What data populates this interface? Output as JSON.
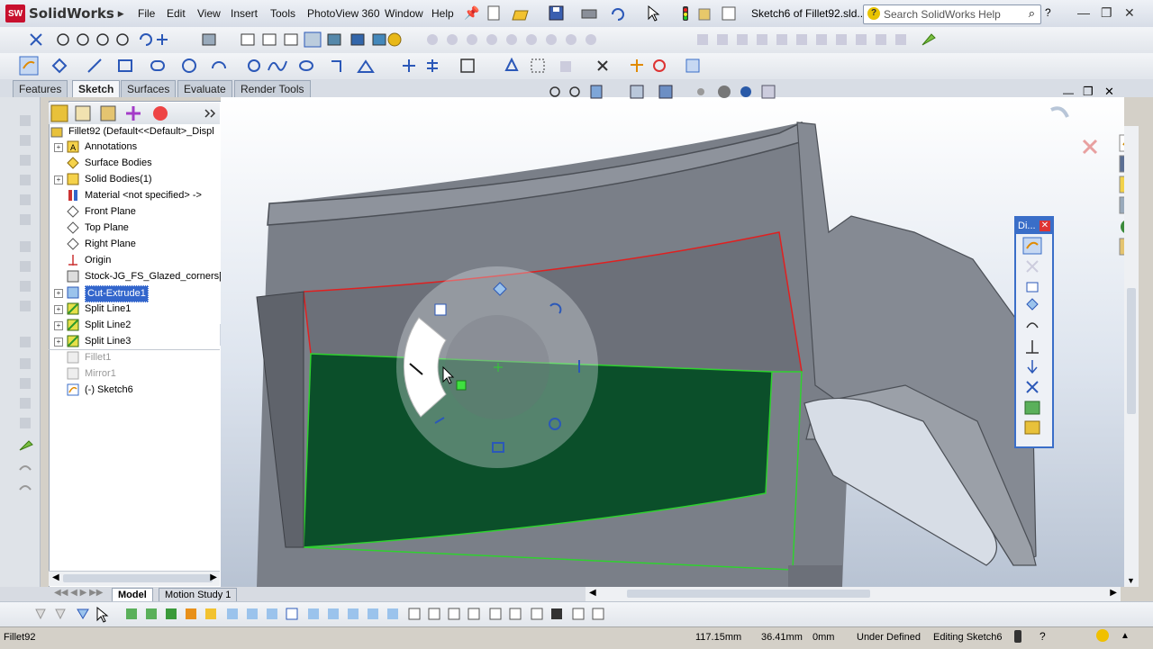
{
  "app": {
    "brand": "SolidWorks",
    "logo_text": "SW",
    "document_title": "Sketch6 of Fillet92.sld...",
    "search_placeholder": "Search SolidWorks Help"
  },
  "menu": [
    "File",
    "Edit",
    "View",
    "Insert",
    "Tools",
    "PhotoView 360",
    "Window",
    "Help"
  ],
  "command_tabs": [
    {
      "label": "Features",
      "active": false
    },
    {
      "label": "Sketch",
      "active": true
    },
    {
      "label": "Surfaces",
      "active": false
    },
    {
      "label": "Evaluate",
      "active": false
    },
    {
      "label": "Render Tools",
      "active": false
    }
  ],
  "feature_tree": {
    "root": "Fillet92  (Default<<Default>_Displ",
    "items": [
      {
        "label": "Annotations",
        "expand": true,
        "state": "normal"
      },
      {
        "label": "Surface Bodies",
        "expand": false,
        "state": "normal"
      },
      {
        "label": "Solid Bodies(1)",
        "expand": true,
        "state": "normal"
      },
      {
        "label": "Material <not specified> ->",
        "expand": false,
        "state": "normal"
      },
      {
        "label": "Front Plane",
        "expand": false,
        "state": "normal"
      },
      {
        "label": "Top Plane",
        "expand": false,
        "state": "normal"
      },
      {
        "label": "Right Plane",
        "expand": false,
        "state": "normal"
      },
      {
        "label": "Origin",
        "expand": false,
        "state": "normal"
      },
      {
        "label": "Stock-JG_FS_Glazed_corners[F",
        "expand": false,
        "state": "normal"
      },
      {
        "label": "Cut-Extrude1",
        "expand": true,
        "state": "selected"
      },
      {
        "label": "Split Line1",
        "expand": true,
        "state": "normal"
      },
      {
        "label": "Split Line2",
        "expand": true,
        "state": "normal"
      },
      {
        "label": "Split Line3",
        "expand": true,
        "state": "normal"
      },
      {
        "label": "Fillet1",
        "expand": false,
        "state": "grey"
      },
      {
        "label": "Mirror1",
        "expand": false,
        "state": "grey"
      },
      {
        "label": "(-) Sketch6",
        "expand": false,
        "state": "normal"
      }
    ]
  },
  "bottom_tabs": [
    {
      "label": "Model",
      "active": true
    },
    {
      "label": "Motion Study 1",
      "active": false
    }
  ],
  "dimension_toolbar": {
    "title": "Di..."
  },
  "status": {
    "part": "Fillet92",
    "x": "117.15mm",
    "y": "36.41mm",
    "z": "0mm",
    "state": "Under Defined",
    "editing": "Editing Sketch6"
  },
  "colors": {
    "accent": "#3a6ec8",
    "face_green": "#0b4f2a",
    "edge_red": "#e02020",
    "edge_green": "#2fd12f",
    "part_grey": "#7a7f88"
  }
}
